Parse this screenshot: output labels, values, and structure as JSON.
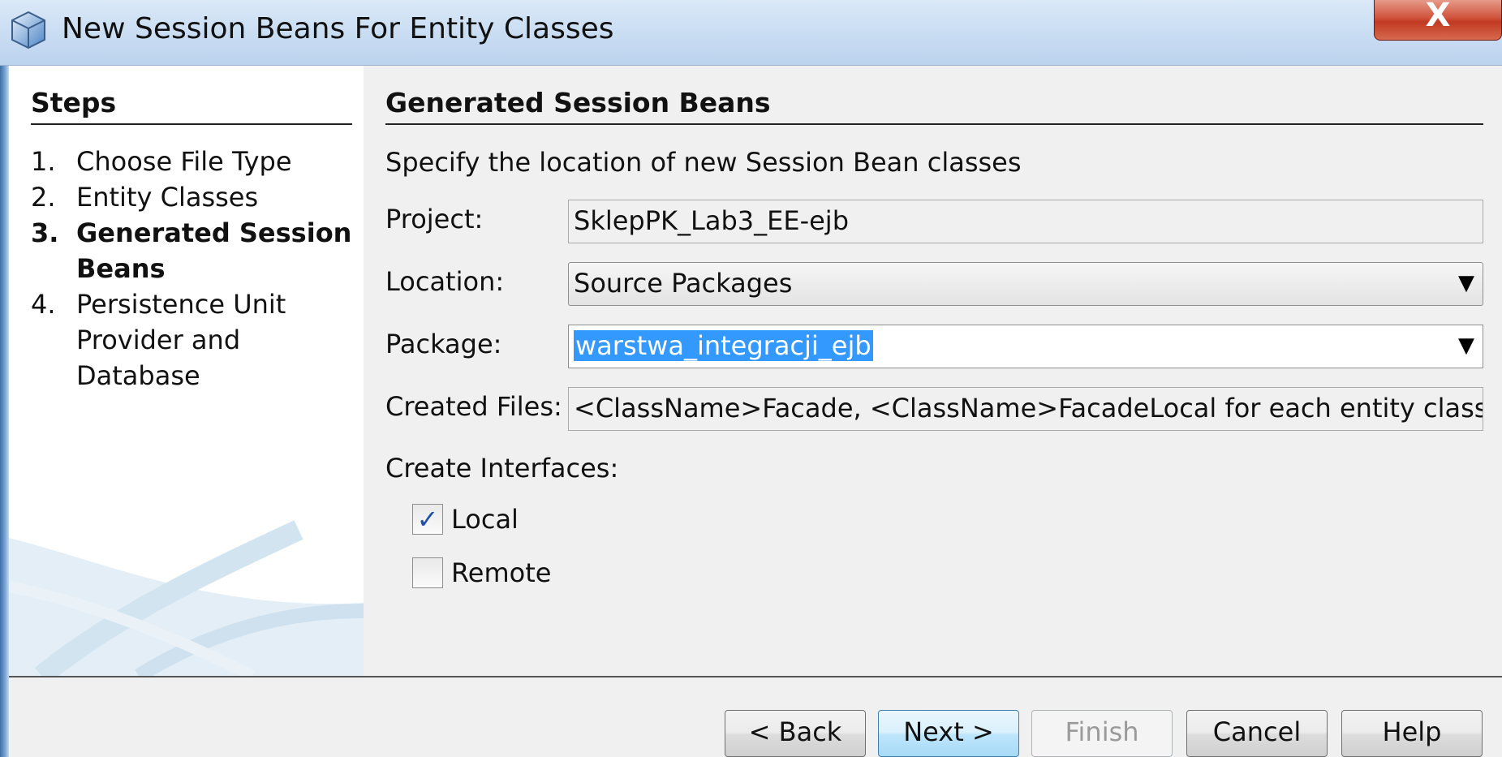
{
  "window": {
    "title": "New Session Beans For Entity Classes",
    "close_label": "X"
  },
  "steps": {
    "title": "Steps",
    "items": [
      {
        "num": "1.",
        "label": "Choose File Type",
        "current": false
      },
      {
        "num": "2.",
        "label": "Entity Classes",
        "current": false
      },
      {
        "num": "3.",
        "label": "Generated Session Beans",
        "current": true
      },
      {
        "num": "4.",
        "label": "Persistence Unit Provider and Database",
        "current": false
      }
    ]
  },
  "main": {
    "title": "Generated Session Beans",
    "description": "Specify the location of new Session Bean classes",
    "project": {
      "label": "Project:",
      "value": "SklepPK_Lab3_EE-ejb"
    },
    "location": {
      "label": "Location:",
      "value": "Source Packages"
    },
    "package": {
      "label": "Package:",
      "value": "warstwa_integracji_ejb"
    },
    "created_files": {
      "label": "Created Files:",
      "value": "<ClassName>Facade, <ClassName>FacadeLocal for each entity class."
    },
    "interfaces": {
      "label": "Create Interfaces:",
      "local": {
        "label": "Local",
        "checked": true
      },
      "remote": {
        "label": "Remote",
        "checked": false
      }
    }
  },
  "buttons": {
    "back": "< Back",
    "next": "Next >",
    "finish": "Finish",
    "cancel": "Cancel",
    "help": "Help"
  },
  "colors": {
    "selection": "#3399ff",
    "checkmark": "#1f4fa8",
    "close_button": "#c13a22"
  }
}
